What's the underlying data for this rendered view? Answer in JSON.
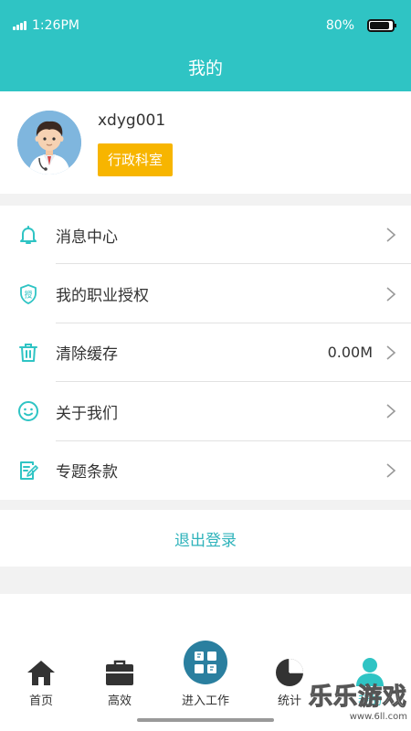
{
  "status_bar": {
    "time": "1:26PM",
    "battery": "80%",
    "battery_level": 0.8
  },
  "header": {
    "title": "我的"
  },
  "profile": {
    "username": "xdyg001",
    "role": "行政科室",
    "avatar_icon": "doctor-avatar-icon"
  },
  "menu": {
    "items": [
      {
        "label": "消息中心",
        "icon": "bell-icon"
      },
      {
        "label": "我的职业授权",
        "icon": "shield-authorize-icon"
      },
      {
        "label": "清除缓存",
        "icon": "trash-icon",
        "value": "0.00M"
      },
      {
        "label": "关于我们",
        "icon": "smiley-icon"
      },
      {
        "label": "专题条款",
        "icon": "document-edit-icon"
      }
    ]
  },
  "shield_text": "授",
  "logout": {
    "label": "退出登录"
  },
  "tabbar": {
    "tabs": [
      {
        "label": "首页",
        "icon": "home-icon"
      },
      {
        "label": "高效",
        "icon": "briefcase-icon"
      },
      {
        "label": "进入工作",
        "icon": "enter-work-icon"
      },
      {
        "label": "统计",
        "icon": "pie-chart-icon"
      },
      {
        "label": "我的",
        "icon": "person-icon",
        "active": true
      }
    ]
  },
  "watermark": {
    "text": "乐乐游戏",
    "sub": "www.6ll.com"
  },
  "colors": {
    "accent": "#2fc4c4",
    "badge": "#f7b500",
    "logout_text": "#2fb3bb",
    "icon": "#2fc4c4",
    "tab_dark": "#333333"
  }
}
